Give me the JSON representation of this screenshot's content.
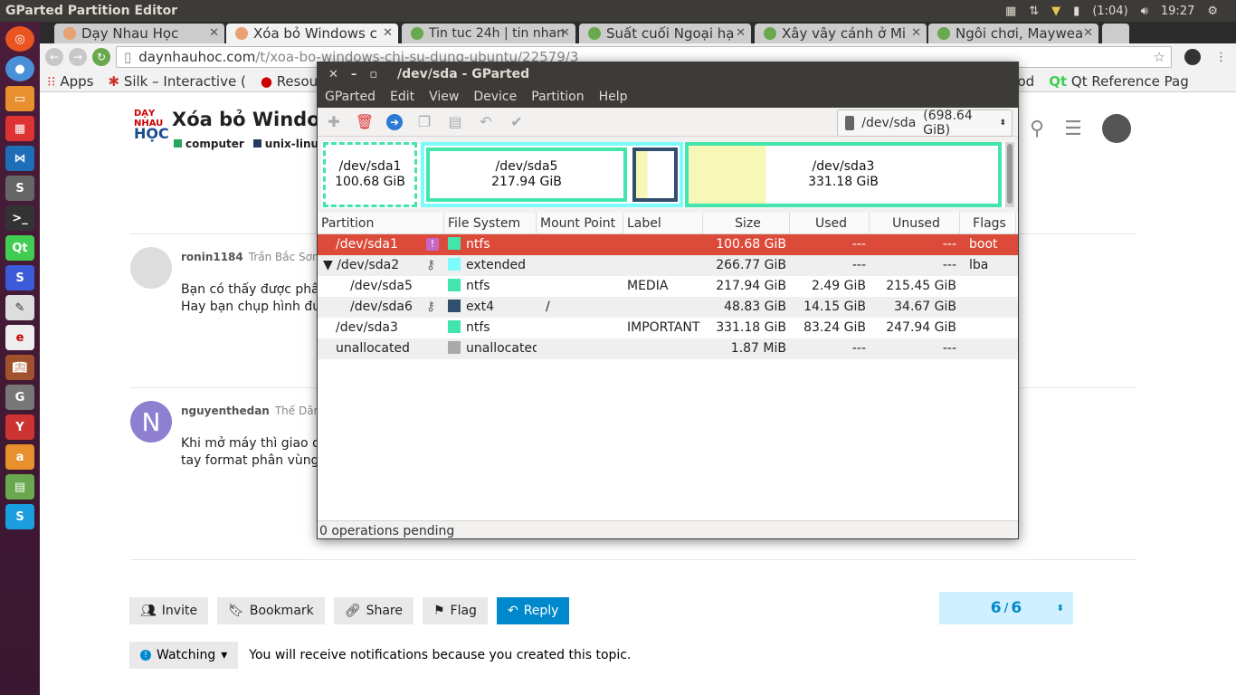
{
  "topbar": {
    "app_title": "GParted Partition Editor",
    "battery": "(1:04)",
    "clock": "19:27"
  },
  "browser": {
    "tabs": [
      {
        "label": "Dạy Nhau Học"
      },
      {
        "label": "Xóa bỏ Windows c"
      },
      {
        "label": "Tin tuc 24h | tin nhan"
      },
      {
        "label": "Suất cuối Ngoại hạ"
      },
      {
        "label": "Xây vây cánh ở Mi"
      },
      {
        "label": "Ngôi chơi, Maywea"
      }
    ],
    "url_domain": "daynhauhoc.com",
    "url_path": "/t/xoa-bo-windows-chi-su-dung-ubuntu/22579/3",
    "bookmarks": [
      "Apps",
      "Silk – Interactive (",
      "Resource",
      "od",
      "Qt Reference Pag"
    ]
  },
  "page": {
    "logo": {
      "line1": "DẠY",
      "line2": "NHAU",
      "line3": "HỌC"
    },
    "title": "Xóa bỏ Window",
    "tags": [
      {
        "label": "computer",
        "color": "#26a65b"
      },
      {
        "label": "unix-linux",
        "color": "#243b5e"
      }
    ],
    "posts": [
      {
        "username": "ronin1184",
        "fullname": "Trần Bắc Sơn",
        "line1": "Bạn có thấy được phân",
        "line2": "Hay bạn chụp hình đưa"
      },
      {
        "username": "nguyenthedan",
        "fullname": "Thế Dân",
        "avatar_letter": "N",
        "line1": "Khi mở máy thì giao diệ",
        "line2": "tay format phân vùng cà"
      }
    ],
    "buttons": {
      "invite": "Invite",
      "bookmark": "Bookmark",
      "share": "Share",
      "flag": "Flag",
      "reply": "Reply"
    },
    "counter": {
      "current": "6",
      "sep": "/",
      "total": "6"
    },
    "watching": {
      "label": "Watching",
      "note": "You will receive notifications because you created this topic."
    }
  },
  "gparted": {
    "window_title": "/dev/sda - GParted",
    "menu": [
      "GParted",
      "Edit",
      "View",
      "Device",
      "Partition",
      "Help"
    ],
    "device": "/dev/sda",
    "device_size": "(698.64 GiB)",
    "diskmap": [
      {
        "name": "/dev/sda1",
        "size": "100.68 GiB"
      },
      {
        "name": "/dev/sda5",
        "size": "217.94 GiB"
      },
      {
        "name": "/dev/sda3",
        "size": "331.18 GiB"
      }
    ],
    "columns": [
      "Partition",
      "File System",
      "Mount Point",
      "Label",
      "Size",
      "Used",
      "Unused",
      "Flags"
    ],
    "rows": [
      {
        "partition": "/dev/sda1",
        "fs": "ntfs",
        "fs_color": "#42e5ac",
        "mount": "",
        "label": "",
        "size": "100.68 GiB",
        "used": "---",
        "unused": "---",
        "flags": "boot"
      },
      {
        "partition": "/dev/sda2",
        "fs": "extended",
        "fs_color": "#7dfcfe",
        "mount": "",
        "label": "",
        "size": "266.77 GiB",
        "used": "---",
        "unused": "---",
        "flags": "lba"
      },
      {
        "partition": "/dev/sda5",
        "fs": "ntfs",
        "fs_color": "#42e5ac",
        "mount": "",
        "label": "MEDIA",
        "size": "217.94 GiB",
        "used": "2.49 GiB",
        "unused": "215.45 GiB",
        "flags": ""
      },
      {
        "partition": "/dev/sda6",
        "fs": "ext4",
        "fs_color": "#314e6c",
        "mount": "/",
        "label": "",
        "size": "48.83 GiB",
        "used": "14.15 GiB",
        "unused": "34.67 GiB",
        "flags": ""
      },
      {
        "partition": "/dev/sda3",
        "fs": "ntfs",
        "fs_color": "#42e5ac",
        "mount": "",
        "label": "IMPORTANT",
        "size": "331.18 GiB",
        "used": "83.24 GiB",
        "unused": "247.94 GiB",
        "flags": ""
      },
      {
        "partition": "unallocated",
        "fs": "unallocated",
        "fs_color": "#a9a9a9",
        "mount": "",
        "label": "",
        "size": "1.87 MiB",
        "used": "---",
        "unused": "---",
        "flags": ""
      }
    ],
    "status": "0 operations pending"
  }
}
